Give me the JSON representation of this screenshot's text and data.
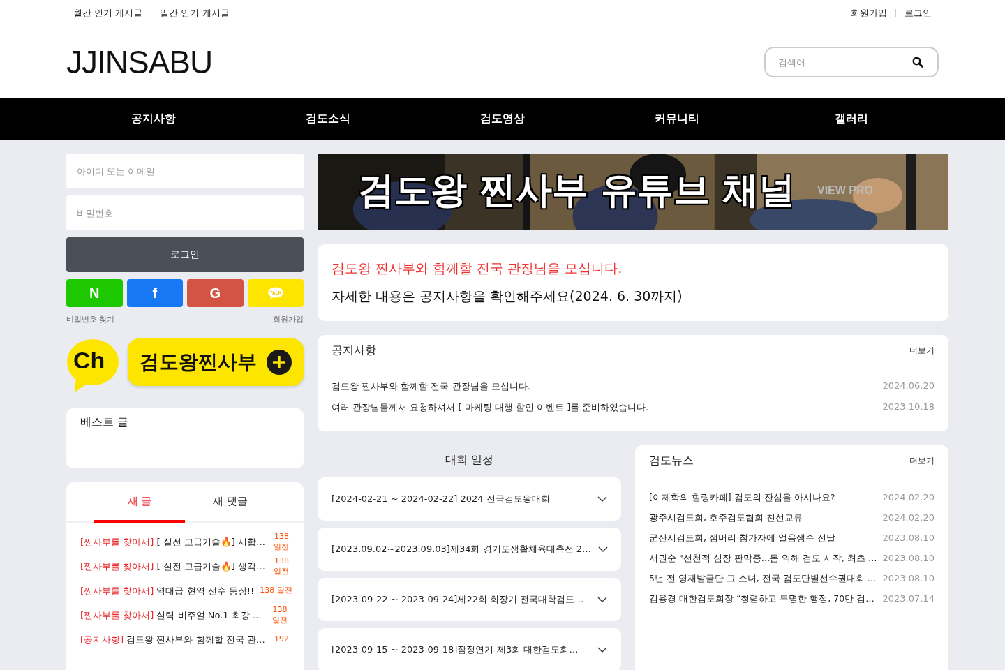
{
  "top_links_left": [
    "월간 인기 게시글",
    "일간 인기 게시글"
  ],
  "top_links_right": [
    "회원가입",
    "로그인"
  ],
  "logo": "JJINSABU",
  "search": {
    "placeholder": "검색어"
  },
  "nav": [
    "공지사항",
    "검도소식",
    "검도영상",
    "커뮤니티",
    "갤러리"
  ],
  "login": {
    "id_placeholder": "아이디 또는 이메일",
    "pw_placeholder": "비밀번호",
    "button": "로그인",
    "social": [
      {
        "kind": "naver",
        "label": "N"
      },
      {
        "kind": "facebook",
        "label": "f"
      },
      {
        "kind": "google",
        "label": "G"
      },
      {
        "kind": "kakao",
        "label": "TALK"
      }
    ],
    "find_password": "비밀번호 찾기",
    "signup": "회원가입"
  },
  "channel": {
    "badge": "Ch",
    "name": "검도왕찐사부"
  },
  "best": {
    "title": "베스트 글"
  },
  "latest": {
    "tabs": [
      {
        "label": "새 글",
        "selected": true
      },
      {
        "label": "새 댓글",
        "selected": false
      }
    ],
    "items": [
      {
        "category": "[찐사부를 찾아서]",
        "title": "[ 실전 고급기술🔥] 시합…",
        "age": "138 일전"
      },
      {
        "category": "[찐사부를 찾아서]",
        "title": "[ 실전 고급기술🔥] 생각…",
        "age": "138 일전"
      },
      {
        "category": "[찐사부를 찾아서]",
        "title": "역대급 현역 선수 등장!!",
        "age": "138 일전"
      },
      {
        "category": "[찐사부를 찾아서]",
        "title": "실력 비주얼 No.1 최강 …",
        "age": "138 일전"
      },
      {
        "category": "[공지사항]",
        "title": "검도왕 찐사부와 함께할 전국 관…",
        "age": "192"
      }
    ]
  },
  "banner": {
    "title": "검도왕 찐사부 유튜브 채널",
    "tag": "VIEW PRO"
  },
  "announcement": {
    "headline": "검도왕 찐사부와 함께할 전국 관장님을 모십니다.",
    "body": "자세한 내용은 공지사항을 확인해주세요(2024. 6. 30까지)"
  },
  "notices": {
    "title": "공지사항",
    "more": "더보기",
    "items": [
      {
        "title": "검도왕 찐사부와 함께할 전국 관장님을 모십니다.",
        "date": "2024.06.20"
      },
      {
        "title": "여러 관장님들께서 요청하셔서 [ 마케팅 대행 할인 이벤트 ]를 준비하였습니다.",
        "date": "2023.10.18"
      }
    ]
  },
  "schedule": {
    "title": "대회 일정",
    "items": [
      {
        "text": "[2024-02-21 ~ 2024-02-22] 2024 전국검도왕대회"
      },
      {
        "text": "[2023.09.02~2023.09.03]제34회 경기도생활체육대축전 2…"
      },
      {
        "text": "[2023-09-22 ~ 2023-09-24]제22회 회장기 전국대학검도…"
      },
      {
        "text": "[2023-09-15 ~ 2023-09-18]잠정연기-제3회 대한검도회…"
      }
    ]
  },
  "news": {
    "title": "검도뉴스",
    "more": "더보기",
    "items": [
      {
        "title": "[이제학의 힐링카페] 검도의 잔심을 아시나요?",
        "date": "2024.02.20"
      },
      {
        "title": "광주시검도회, 호주검도협회 친선교류",
        "date": "2024.02.20"
      },
      {
        "title": "군산시검도회, 잼버리 참가자에 얼음생수 전달",
        "date": "2023.08.10"
      },
      {
        "title": "서권순 \"선천적 심장 판막증…몸 약해 검도 시작, 최초 …",
        "date": "2023.08.10"
      },
      {
        "title": "5년 전 영재발굴단 그 소녀, 전국 검도단별선수권대회 …",
        "date": "2023.08.10"
      },
      {
        "title": "김용경 대한검도회장 “청렴하고 투명한 행정, 70만 검…",
        "date": "2023.07.14"
      }
    ]
  }
}
